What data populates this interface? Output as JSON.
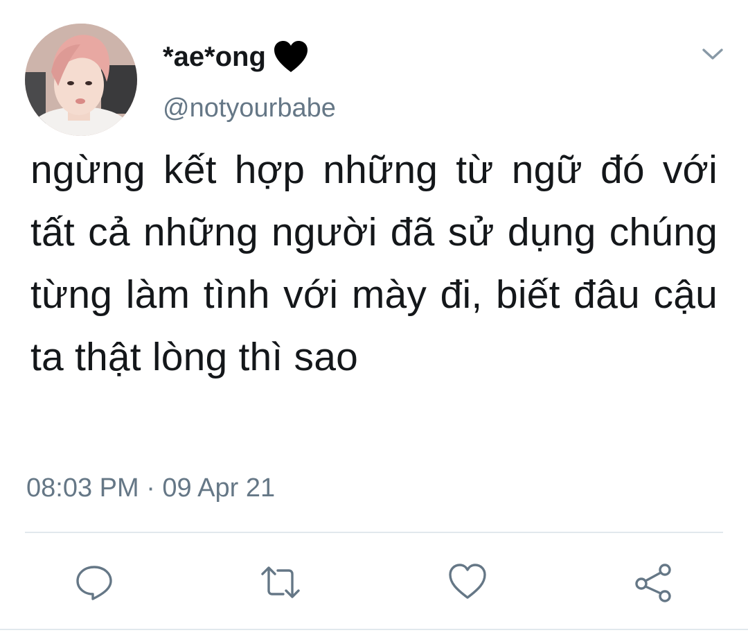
{
  "tweet": {
    "display_name": "*ae*ong",
    "display_name_emoji": "black-heart-icon",
    "username": "@notyourbabe",
    "text": "ngừng kết hợp những từ ngữ đó với tất cả những người đã sử dụng chúng từng làm tình với mày đi, biết đâu cậu ta thật lòng thì sao",
    "timestamp": "08:03 PM · 09 Apr 21"
  },
  "actions": {
    "reply_icon": "reply-icon",
    "retweet_icon": "retweet-icon",
    "like_icon": "heart-icon",
    "share_icon": "share-icon"
  },
  "colors": {
    "text": "#14171a",
    "secondary": "#657786",
    "divider": "#e1e8ed",
    "background": "#ffffff"
  }
}
